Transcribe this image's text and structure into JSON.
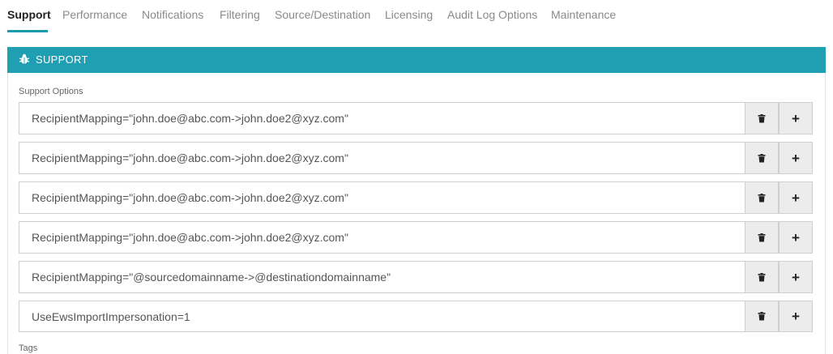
{
  "tabs": [
    {
      "label": "Support",
      "active": true
    },
    {
      "label": "Performance"
    },
    {
      "label": "Notifications"
    },
    {
      "label": "Filtering"
    },
    {
      "label": "Source/Destination"
    },
    {
      "label": "Licensing"
    },
    {
      "label": "Audit Log Options"
    },
    {
      "label": "Maintenance"
    }
  ],
  "panel": {
    "title": "SUPPORT",
    "icon": "bug-icon",
    "accent_color": "#1f9fb1"
  },
  "support_options": {
    "label": "Support Options",
    "rows": [
      {
        "value": "RecipientMapping=\"john.doe@abc.com->john.doe2@xyz.com\""
      },
      {
        "value": "RecipientMapping=\"john.doe@abc.com->john.doe2@xyz.com\""
      },
      {
        "value": "RecipientMapping=\"john.doe@abc.com->john.doe2@xyz.com\""
      },
      {
        "value": "RecipientMapping=\"john.doe@abc.com->john.doe2@xyz.com\""
      },
      {
        "value": "RecipientMapping=\"@sourcedomainname->@destinationdomainname\""
      },
      {
        "value": "UseEwsImportImpersonation=1"
      }
    ],
    "delete_icon": "trash-icon",
    "add_label": "+"
  },
  "tags": {
    "label": "Tags"
  }
}
